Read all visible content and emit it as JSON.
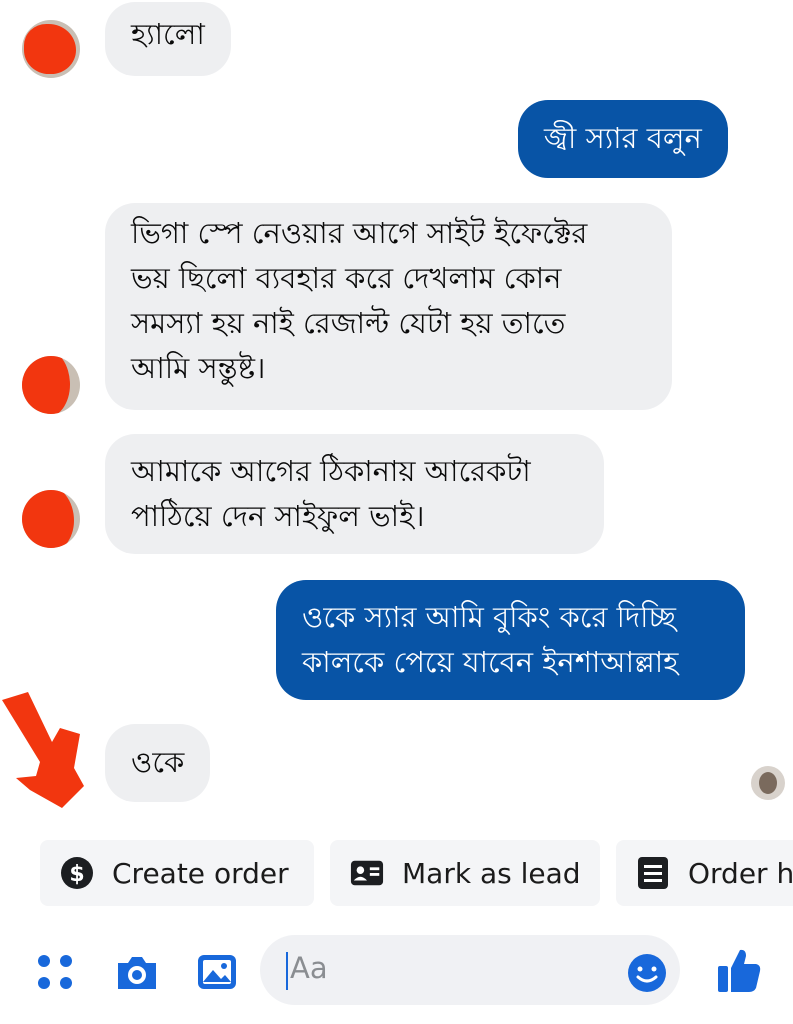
{
  "messages": [
    {
      "text": "হ্যালো"
    },
    {
      "text": "জ্বী স্যার বলুন"
    },
    {
      "text": "ভিগা স্পে নেওয়ার আগে সাইট ইফেক্টের\nভয় ছিলো ব্যবহার করে দেখলাম কোন\nসমস্যা হয় নাই রেজাল্ট যেটা হয় তাতে\nআমি সন্তুষ্ট।"
    },
    {
      "text": "আমাকে আগের ঠিকানায় আরেকটা\nপাঠিয়ে দেন সাইফুল ভাই।"
    },
    {
      "text": "ওকে স্যার আমি বুকিং করে দিচ্ছি\nকালকে পেয়ে যাবেন ইনশাআল্লাহ"
    },
    {
      "text": "ওকে"
    }
  ],
  "quick_actions": [
    {
      "label": "Create order",
      "icon": "dollar-icon"
    },
    {
      "label": "Mark as lead",
      "icon": "contact-card-icon"
    },
    {
      "label": "Order h",
      "icon": "order-list-icon"
    }
  ],
  "composer": {
    "placeholder": "Aa",
    "icons": [
      "apps-grid-icon",
      "camera-icon",
      "gallery-icon",
      "emoji-icon",
      "thumbs-up-icon"
    ]
  },
  "colors": {
    "outgoing_bubble": "#0854a6",
    "incoming_bubble": "#eeeff1",
    "accent": "#1868db",
    "redaction": "#f2360f"
  }
}
